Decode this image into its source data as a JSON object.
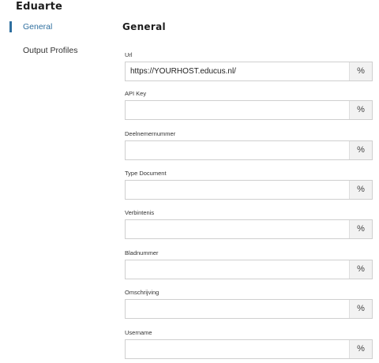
{
  "app": {
    "title": "Eduarte"
  },
  "sidebar": {
    "items": [
      {
        "label": "General",
        "active": true
      },
      {
        "label": "Output Profiles",
        "active": false
      }
    ]
  },
  "main": {
    "section_title": "General",
    "fields": [
      {
        "label": "Url",
        "value": "https://YOURHOST.educus.nl/",
        "button": "%"
      },
      {
        "label": "API Key",
        "value": "",
        "button": "%"
      },
      {
        "label": "Deelnemernummer",
        "value": "",
        "button": "%"
      },
      {
        "label": "Type Document",
        "value": "",
        "button": "%"
      },
      {
        "label": "Verbintenis",
        "value": "",
        "button": "%"
      },
      {
        "label": "Bladnummer",
        "value": "",
        "button": "%"
      },
      {
        "label": "Omschrijving",
        "value": "",
        "button": "%"
      },
      {
        "label": "Username",
        "value": "",
        "button": "%"
      }
    ]
  },
  "colors": {
    "accent": "#2f6f9f",
    "border": "#cfcfcf",
    "button_bg": "#f2f2f2"
  }
}
